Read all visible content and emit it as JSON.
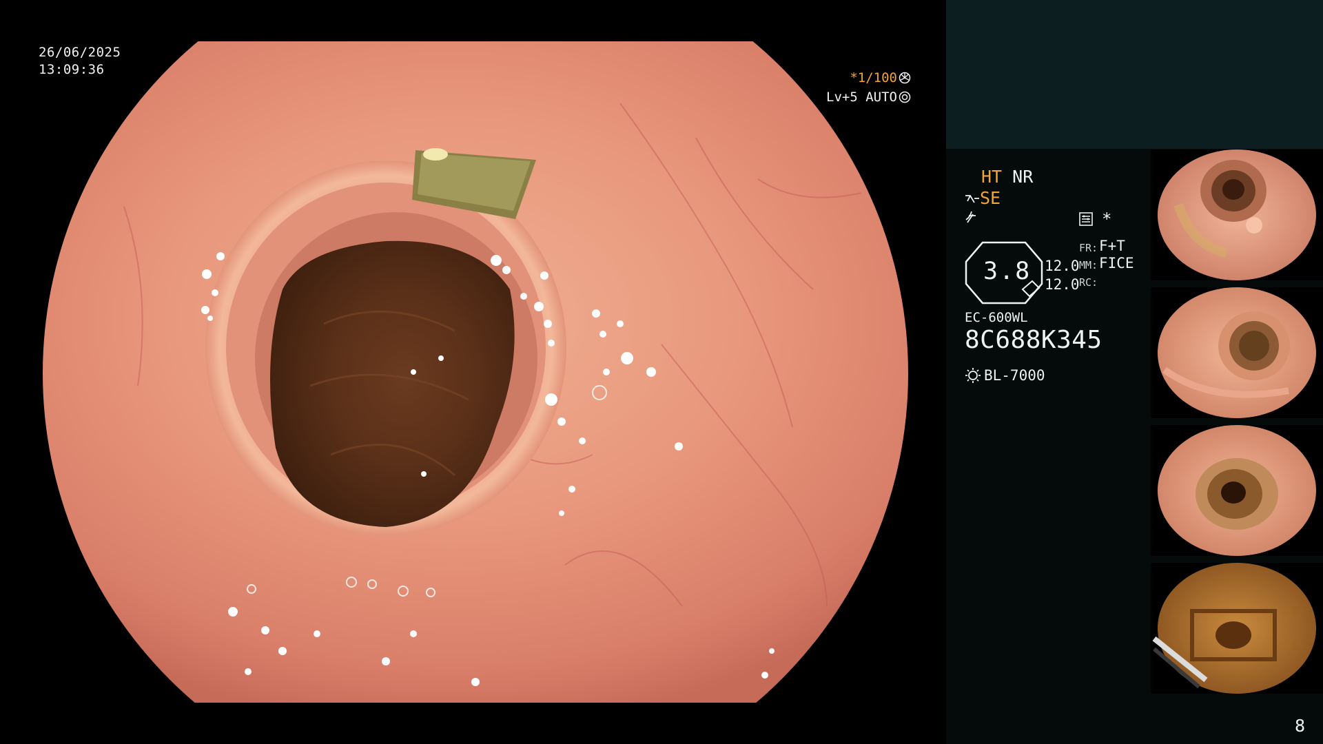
{
  "datetime": {
    "date": "26/06/2025",
    "time": "13:09:36"
  },
  "shutter": {
    "speed": "*1/100",
    "level": "Lv+5",
    "mode": "AUTO"
  },
  "settings": {
    "ht": "HT",
    "nr": "NR",
    "se": "SE",
    "star": "*",
    "zoom": "3.8",
    "val_top": "12.0",
    "val_bottom": "12.0",
    "label_fr": "FR:",
    "label_mm": "MM:",
    "label_rc": "RC:",
    "fr_value": "F+T",
    "mm_value": "FICE",
    "scope_model": "EC-600WL",
    "scope_serial": "8C688K345",
    "light_source": "BL-7000"
  },
  "thumbnails": [
    {
      "label": "thumbnail-1"
    },
    {
      "label": "thumbnail-2"
    },
    {
      "label": "thumbnail-3"
    },
    {
      "label": "thumbnail-4"
    }
  ],
  "page_number": "8",
  "colors": {
    "accent": "#f3a437",
    "panel": "#0c1e1f",
    "mucosa": "#e5957c"
  }
}
